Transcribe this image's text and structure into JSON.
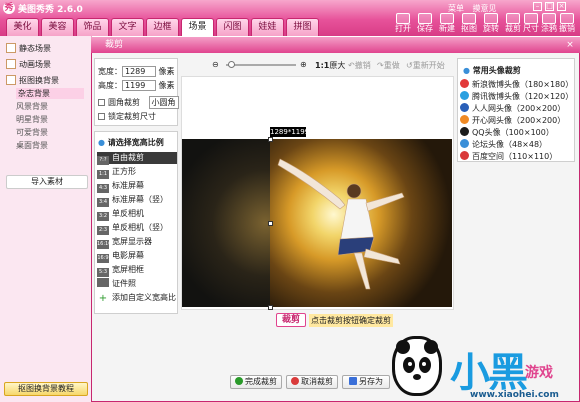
{
  "app": {
    "title": "美图秀秀 2.6.0",
    "logo": "秀"
  },
  "top_links": [
    "菜单",
    "摸意见"
  ],
  "tabs": [
    "美化",
    "美容",
    "饰品",
    "文字",
    "边框",
    "场景",
    "闪图",
    "娃娃",
    "拼图"
  ],
  "active_tab": "场景",
  "toolbar": [
    "打开",
    "保存",
    "新建",
    "抠图",
    "旋转",
    "裁剪",
    "尺寸",
    "涂鸦",
    "撤销",
    "重做"
  ],
  "sidebar": {
    "items": [
      "静态场景",
      "动画场景",
      "抠图换背景"
    ],
    "subitems": [
      "杂志背景",
      "风景背景",
      "明星背景",
      "可爱背景",
      "桌面背景"
    ],
    "selected_subitem": "杂志背景",
    "import_label": "导入素材",
    "tutorial_label": "抠图换背景教程"
  },
  "dialog": {
    "title": "裁剪",
    "width_label": "宽度：",
    "width_value": "1289",
    "width_unit": "像素",
    "height_label": "高度：",
    "height_value": "1199",
    "height_unit": "像素",
    "rounded_label": "圆角裁剪",
    "rounded_option": "小圆角",
    "lock_label": "锁定裁剪尺寸",
    "ratio_title": "请选择宽高比例",
    "ratios": [
      {
        "icon": "?:?",
        "label": "自由裁剪"
      },
      {
        "icon": "1:1",
        "label": "正方形"
      },
      {
        "icon": "4:3",
        "label": "标准屏幕"
      },
      {
        "icon": "3:4",
        "label": "标准屏幕（竖）"
      },
      {
        "icon": "3:2",
        "label": "单反相机"
      },
      {
        "icon": "2:3",
        "label": "单反相机（竖）"
      },
      {
        "icon": "16:10",
        "label": "宽屏显示器"
      },
      {
        "icon": "16:9",
        "label": "电影屏幕"
      },
      {
        "icon": "5:3",
        "label": "宽屏相框"
      },
      {
        "icon": "",
        "label": "证件照"
      },
      {
        "icon": "+",
        "label": "添加自定义宽高比"
      }
    ],
    "selected_ratio": "自由裁剪",
    "canvas_tools": [
      "1:1",
      "原大",
      "撤销",
      "重做",
      "重新开始"
    ],
    "crop_size_label": "1289*1199",
    "crop_button": "裁剪",
    "crop_hint": "点击裁剪按钮确定裁剪",
    "avatar_title": "常用头像裁剪",
    "avatars": [
      {
        "label": "新浪微博头像（180×180）",
        "color": "#e23a3a"
      },
      {
        "label": "腾讯微博头像（120×120）",
        "color": "#2aa0e0"
      },
      {
        "label": "人人网头像（200×200）",
        "color": "#2a5fb8"
      },
      {
        "label": "开心网头像（200×200）",
        "color": "#f08a24"
      },
      {
        "label": "QQ头像（100×100）",
        "color": "#1c1c1c"
      },
      {
        "label": "论坛头像（48×48）",
        "color": "#3a8fd8"
      },
      {
        "label": "百度空间（110×110）",
        "color": "#d93a3a"
      }
    ],
    "bottom_buttons": [
      "完成裁剪",
      "取消裁剪",
      "另存为"
    ]
  },
  "watermark": {
    "brand": "小黑",
    "game": "游戏",
    "url": "www.xiaohei.com"
  }
}
